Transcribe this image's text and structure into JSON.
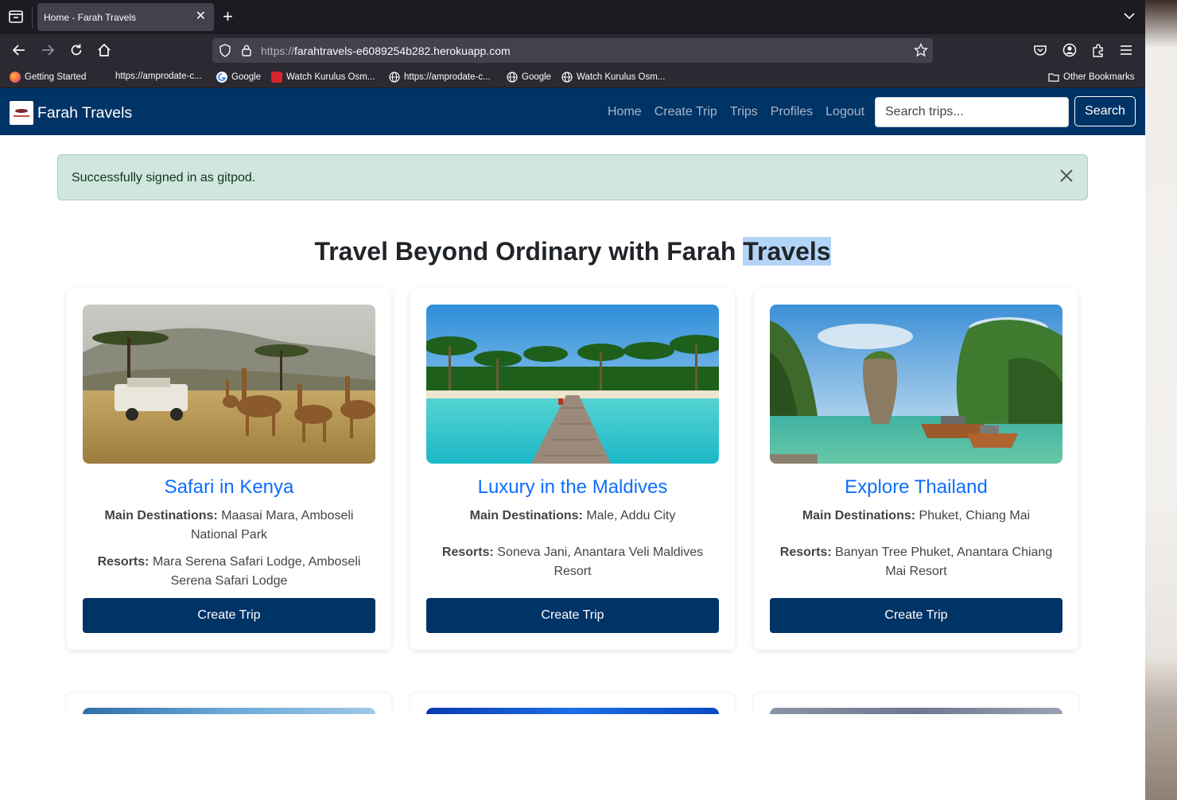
{
  "browser": {
    "tab_title": "Home - Farah Travels",
    "url_prefix": "https://",
    "url_host": "farahtravels-e6089254b282.herokuapp.com",
    "bookmarks": [
      {
        "label": "Getting Started",
        "icon": "firefox-icon"
      },
      {
        "label": "https://amprodate-c...",
        "icon": "blank-icon"
      },
      {
        "label": "Google",
        "icon": "google-icon"
      },
      {
        "label": "Watch Kurulus Osm...",
        "icon": "red-logo-icon"
      },
      {
        "label": "https://amprodate-c...",
        "icon": "globe-icon"
      },
      {
        "label": "Google",
        "icon": "globe-icon"
      },
      {
        "label": "Watch Kurulus Osm...",
        "icon": "globe-icon"
      }
    ],
    "other_bookmarks": "Other Bookmarks"
  },
  "site": {
    "brand": "Farah Travels",
    "nav": [
      "Home",
      "Create Trip",
      "Trips",
      "Profiles",
      "Logout"
    ],
    "search_placeholder": "Search trips...",
    "search_button": "Search"
  },
  "alert": {
    "message": "Successfully signed in as gitpod."
  },
  "hero": {
    "title_main": "Travel Beyond Ordinary with Farah ",
    "title_highlight": "Travels"
  },
  "labels": {
    "destinations": "Main Destinations:",
    "resorts": "Resorts:"
  },
  "cards": [
    {
      "title": "Safari in Kenya",
      "destinations": "Maasai Mara, Amboseli National Park",
      "resorts": "Mara Serena Safari Lodge, Amboseli Serena Safari Lodge",
      "button": "Create Trip",
      "image": "safari-giraffes-image"
    },
    {
      "title": "Luxury in the Maldives",
      "destinations": "Male, Addu City",
      "resorts": "Soneva Jani, Anantara Veli Maldives Resort",
      "button": "Create Trip",
      "image": "maldives-pier-image"
    },
    {
      "title": "Explore Thailand",
      "destinations": "Phuket, Chiang Mai",
      "resorts": "Banyan Tree Phuket, Anantara Chiang Mai Resort",
      "button": "Create Trip",
      "image": "thailand-cliffs-boats-image"
    }
  ],
  "colors": {
    "navy": "#003366",
    "link_blue": "#0d6efd",
    "alert_bg": "#d1e7dd"
  }
}
